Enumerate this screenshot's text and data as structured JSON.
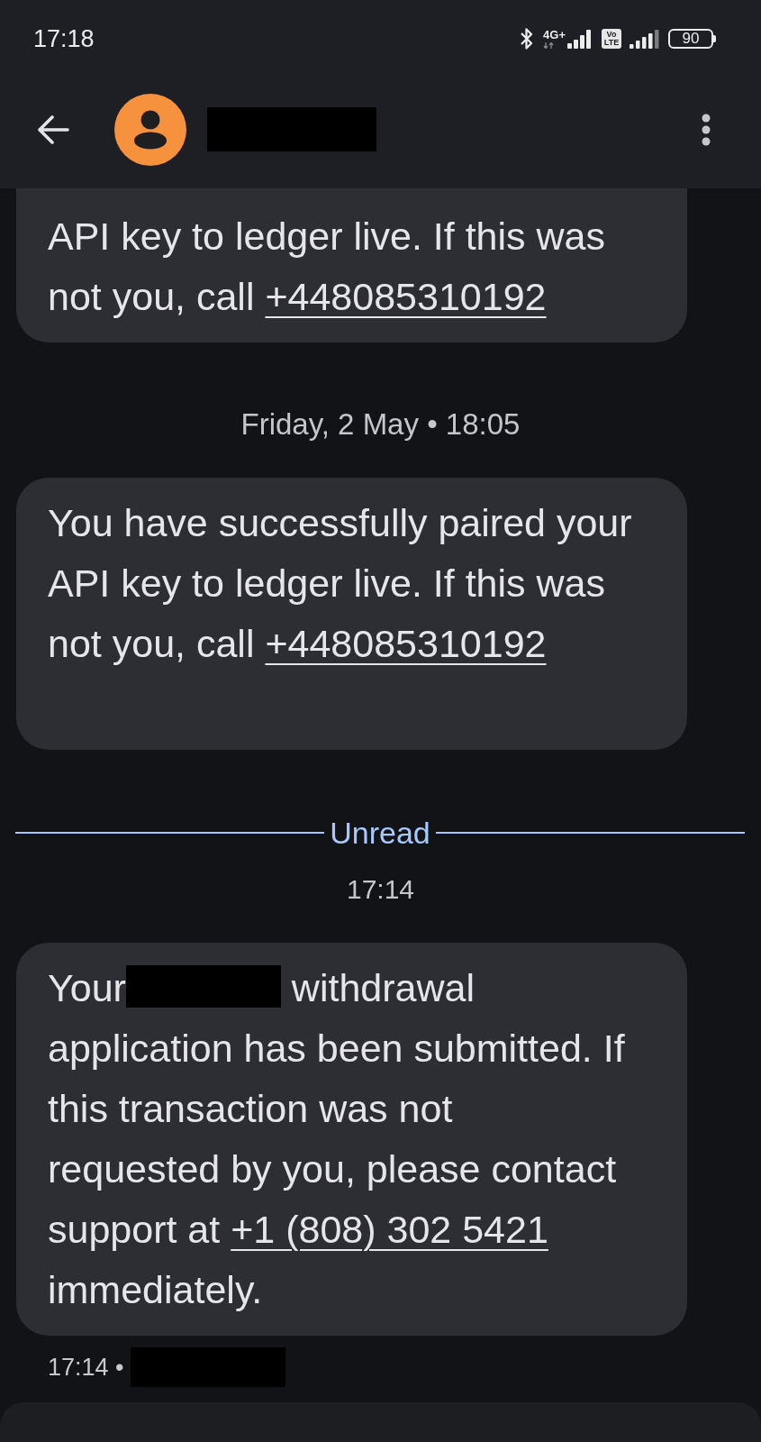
{
  "status_bar": {
    "time": "17:18",
    "network": "4G+",
    "volte": [
      "Vo",
      "LTE"
    ],
    "battery": "90"
  },
  "header": {
    "contact_name": {
      "kind": "redacted"
    }
  },
  "conversation": [
    {
      "kind": "message",
      "cut_off_top": true,
      "blank_line_after": false,
      "segments": [
        {
          "kind": "text",
          "text": "API key to ledger live. If this was\nnot you, call "
        },
        {
          "kind": "link",
          "text": "+448085310192"
        }
      ]
    },
    {
      "kind": "date",
      "text": "Friday, 2 May • 18:05"
    },
    {
      "kind": "message",
      "cut_off_top": false,
      "blank_line_after": true,
      "segments": [
        {
          "kind": "text",
          "text": "You have successfully paired your\nAPI key to ledger live. If this was\nnot you, call "
        },
        {
          "kind": "link",
          "text": "+448085310192"
        }
      ]
    },
    {
      "kind": "unread",
      "text": "Unread"
    },
    {
      "kind": "time",
      "text": "17:14"
    },
    {
      "kind": "message",
      "cut_off_top": false,
      "blank_line_after": false,
      "segments": [
        {
          "kind": "text",
          "text": "Your"
        },
        {
          "kind": "redacted"
        },
        {
          "kind": "text",
          "text": " withdrawal\napplication has been submitted. If\nthis transaction was not\nrequested by you, please contact\nsupport at "
        },
        {
          "kind": "link",
          "text": "+1 (808) 302 5421"
        },
        {
          "kind": "text",
          "text": "\nimmediately."
        }
      ]
    }
  ],
  "message_footer": {
    "segments": [
      {
        "kind": "text",
        "text": "17:14 •"
      },
      {
        "kind": "redacted"
      }
    ]
  }
}
